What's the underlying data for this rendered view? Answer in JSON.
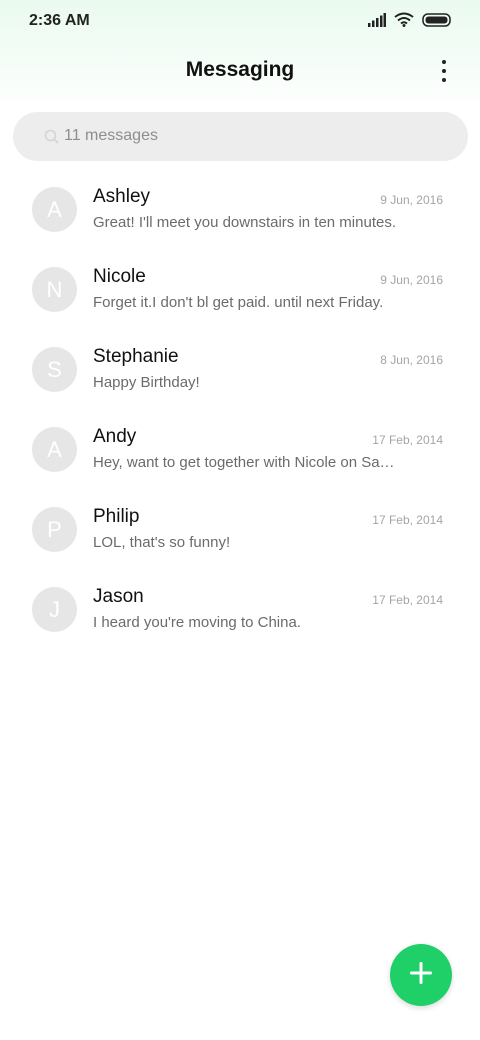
{
  "status_bar": {
    "time": "2:36 AM",
    "icons": [
      "signal-icon",
      "wifi-icon",
      "battery-icon"
    ]
  },
  "app_bar": {
    "title": "Messaging",
    "menu_icon": "more-vert-icon"
  },
  "search": {
    "icon": "search-icon",
    "text": "11 messages"
  },
  "messages": [
    {
      "initial": "A",
      "name": "Ashley",
      "date": "9 Jun, 2016",
      "preview": "Great! I'll meet you downstairs in ten minutes."
    },
    {
      "initial": "N",
      "name": "Nicole",
      "date": "9 Jun, 2016",
      "preview": "Forget it.I don't bl get paid. until next Friday."
    },
    {
      "initial": "S",
      "name": "Stephanie",
      "date": "8 Jun, 2016",
      "preview": "Happy Birthday!"
    },
    {
      "initial": "A",
      "name": "Andy",
      "date": "17 Feb, 2014",
      "preview": "Hey, want to get together with Nicole on Saturday?"
    },
    {
      "initial": "P",
      "name": "Philip",
      "date": "17 Feb, 2014",
      "preview": "LOL, that's so funny!"
    },
    {
      "initial": "J",
      "name": "Jason",
      "date": "17 Feb, 2014",
      "preview": "I heard you're moving to China."
    }
  ],
  "fab": {
    "icon": "plus-icon"
  },
  "colors": {
    "accent": "#1ed067",
    "header_tint": "#eafaef",
    "avatar_bg": "#e6e6e6",
    "search_bg": "#ededed"
  }
}
